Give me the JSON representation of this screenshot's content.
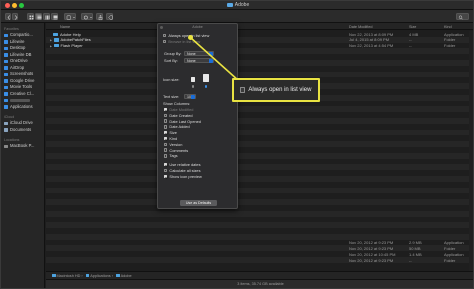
{
  "window": {
    "title": "Adobe"
  },
  "toolbar": {
    "buttons": [
      "back",
      "forward",
      "icon-view",
      "list-view",
      "column-view",
      "gallery-view",
      "group",
      "action",
      "share",
      "tags",
      "search"
    ]
  },
  "sidebar": {
    "sections": [
      {
        "label": "Favorites",
        "items": [
          {
            "label": "Compartio...",
            "icon": "folder-icon",
            "color": "#3a8ee6"
          },
          {
            "label": "Lifewire",
            "icon": "folder-icon",
            "color": "#3a8ee6"
          },
          {
            "label": "Desktop",
            "icon": "desktop-icon",
            "color": "#3a8ee6"
          },
          {
            "label": "Lifewire DB",
            "icon": "folder-icon",
            "color": "#3a8ee6"
          },
          {
            "label": "OneDrive",
            "icon": "cloud-icon",
            "color": "#3a8ee6"
          },
          {
            "label": "AirDrop",
            "icon": "airdrop-icon",
            "color": "#3a8ee6"
          },
          {
            "label": "Screenshots",
            "icon": "folder-icon",
            "color": "#3a8ee6"
          },
          {
            "label": "Google Drive",
            "icon": "drive-icon",
            "color": "#3a8ee6"
          },
          {
            "label": "Movie Tools",
            "icon": "folder-icon",
            "color": "#3a8ee6"
          },
          {
            "label": "Creative Cl...",
            "icon": "creative-cloud-icon",
            "color": "#3a8ee6"
          },
          {
            "label": "",
            "icon": "folder-icon",
            "color": "#3a8ee6"
          },
          {
            "label": "Applications",
            "icon": "applications-icon",
            "color": "#3a8ee6"
          }
        ]
      },
      {
        "label": "iCloud",
        "items": [
          {
            "label": "iCloud Drive",
            "icon": "icloud-icon",
            "color": "#8aa4bf"
          },
          {
            "label": "Documents",
            "icon": "document-icon",
            "color": "#8aa4bf"
          }
        ]
      },
      {
        "label": "Locations",
        "items": [
          {
            "label": "MacBook P...",
            "icon": "laptop-icon",
            "color": "#8a8a8a"
          }
        ]
      }
    ]
  },
  "columns": {
    "name": "Name",
    "date_modified": "Date Modified",
    "size": "Size",
    "kind": "Kind"
  },
  "files": [
    {
      "name": "Adobe Help",
      "expandable": false,
      "date": "Nov 22, 2013 at 8:09 PM",
      "size": "4 MB",
      "kind": "Application"
    },
    {
      "name": "AdobePatchFiles",
      "expandable": true,
      "date": "Jul 4, 2015 at 8:09 PM",
      "size": "--",
      "kind": "Folder"
    },
    {
      "name": "Flash Player",
      "expandable": true,
      "date": "Nov 22, 2013 at 4:54 PM",
      "size": "--",
      "kind": "Folder"
    },
    {
      "name": "",
      "expandable": false,
      "date": "",
      "size": "",
      "kind": ""
    },
    {
      "name": "",
      "expandable": false,
      "date": "",
      "size": "",
      "kind": ""
    },
    {
      "name": "",
      "expandable": false,
      "date": "",
      "size": "",
      "kind": ""
    },
    {
      "name": "",
      "expandable": false,
      "date": "",
      "size": "",
      "kind": ""
    },
    {
      "name": "",
      "expandable": false,
      "date": "",
      "size": "",
      "kind": ""
    },
    {
      "name": "",
      "expandable": false,
      "date": "",
      "size": "",
      "kind": ""
    },
    {
      "name": "",
      "expandable": false,
      "date": "",
      "size": "",
      "kind": ""
    }
  ],
  "bottom_rows": [
    {
      "date": "Nov 20, 2012 at 9:23 PM",
      "size": "2.9 MB",
      "kind": "Application"
    },
    {
      "date": "Nov 20, 2012 at 9:23 PM",
      "size": "50 MB",
      "kind": "Folder"
    },
    {
      "date": "Nov 20, 2012 at 10:45 PM",
      "size": "1.4 MB",
      "kind": "Application"
    },
    {
      "date": "Nov 20, 2012 at 9:23 PM",
      "size": "--",
      "kind": "Folder"
    }
  ],
  "path_bar": {
    "segments": [
      "Macintosh HD",
      "Applications",
      "Adobe"
    ]
  },
  "status_bar": {
    "text": "3 items, 35.74 GB available"
  },
  "view_options": {
    "title": "Adobe",
    "always_open_in_list_view": "Always open in list view",
    "browse_in_list_view": "Browse in list view",
    "group_by_label": "Group By:",
    "group_by_value": "None",
    "sort_by_label": "Sort By:",
    "sort_by_value": "None",
    "icon_size_label": "Icon size:",
    "text_size_label": "Text size:",
    "text_size_value": "10",
    "show_columns_label": "Show Columns:",
    "columns": [
      {
        "label": "Date Modified",
        "checked": true
      },
      {
        "label": "Date Created",
        "checked": false
      },
      {
        "label": "Date Last Opened",
        "checked": false
      },
      {
        "label": "Date Added",
        "checked": false
      },
      {
        "label": "Size",
        "checked": true
      },
      {
        "label": "Kind",
        "checked": true
      },
      {
        "label": "Version",
        "checked": false
      },
      {
        "label": "Comments",
        "checked": false
      },
      {
        "label": "Tags",
        "checked": false
      }
    ],
    "options": [
      {
        "label": "Use relative dates",
        "checked": true
      },
      {
        "label": "Calculate all sizes",
        "checked": false
      },
      {
        "label": "Show icon preview",
        "checked": true
      }
    ],
    "use_as_defaults": "Use as Defaults"
  },
  "callout": {
    "label": "Always open in list view",
    "border_color": "#e9e342"
  }
}
